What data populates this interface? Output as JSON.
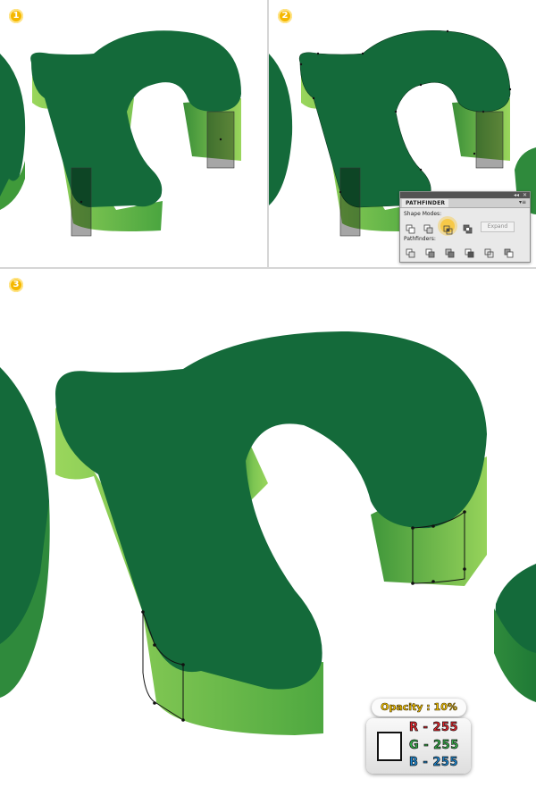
{
  "steps": {
    "one": "1",
    "two": "2",
    "three": "3"
  },
  "pathfinder": {
    "title": "PATHFINDER",
    "menu_icon": "panel-menu-icon",
    "window_controls": [
      "collapse-icon",
      "close-icon"
    ],
    "shape_modes_label": "Shape Modes:",
    "pathfinders_label": "Pathfinders:",
    "expand_label": "Expand",
    "highlighted_mode": "intersect"
  },
  "info": {
    "opacity": "Opacity : 10%",
    "swatch_color": "#ffffff",
    "r": "R - 255",
    "g": "G - 255",
    "b": "B - 255"
  },
  "colors": {
    "top_face": "#146a3a",
    "side_light": "#96d35a",
    "side_dark": "#3f9a3a",
    "badge": "#f5b800",
    "r_text": "#e8242b",
    "g_text": "#36b34a",
    "b_text": "#1d8ad6"
  }
}
